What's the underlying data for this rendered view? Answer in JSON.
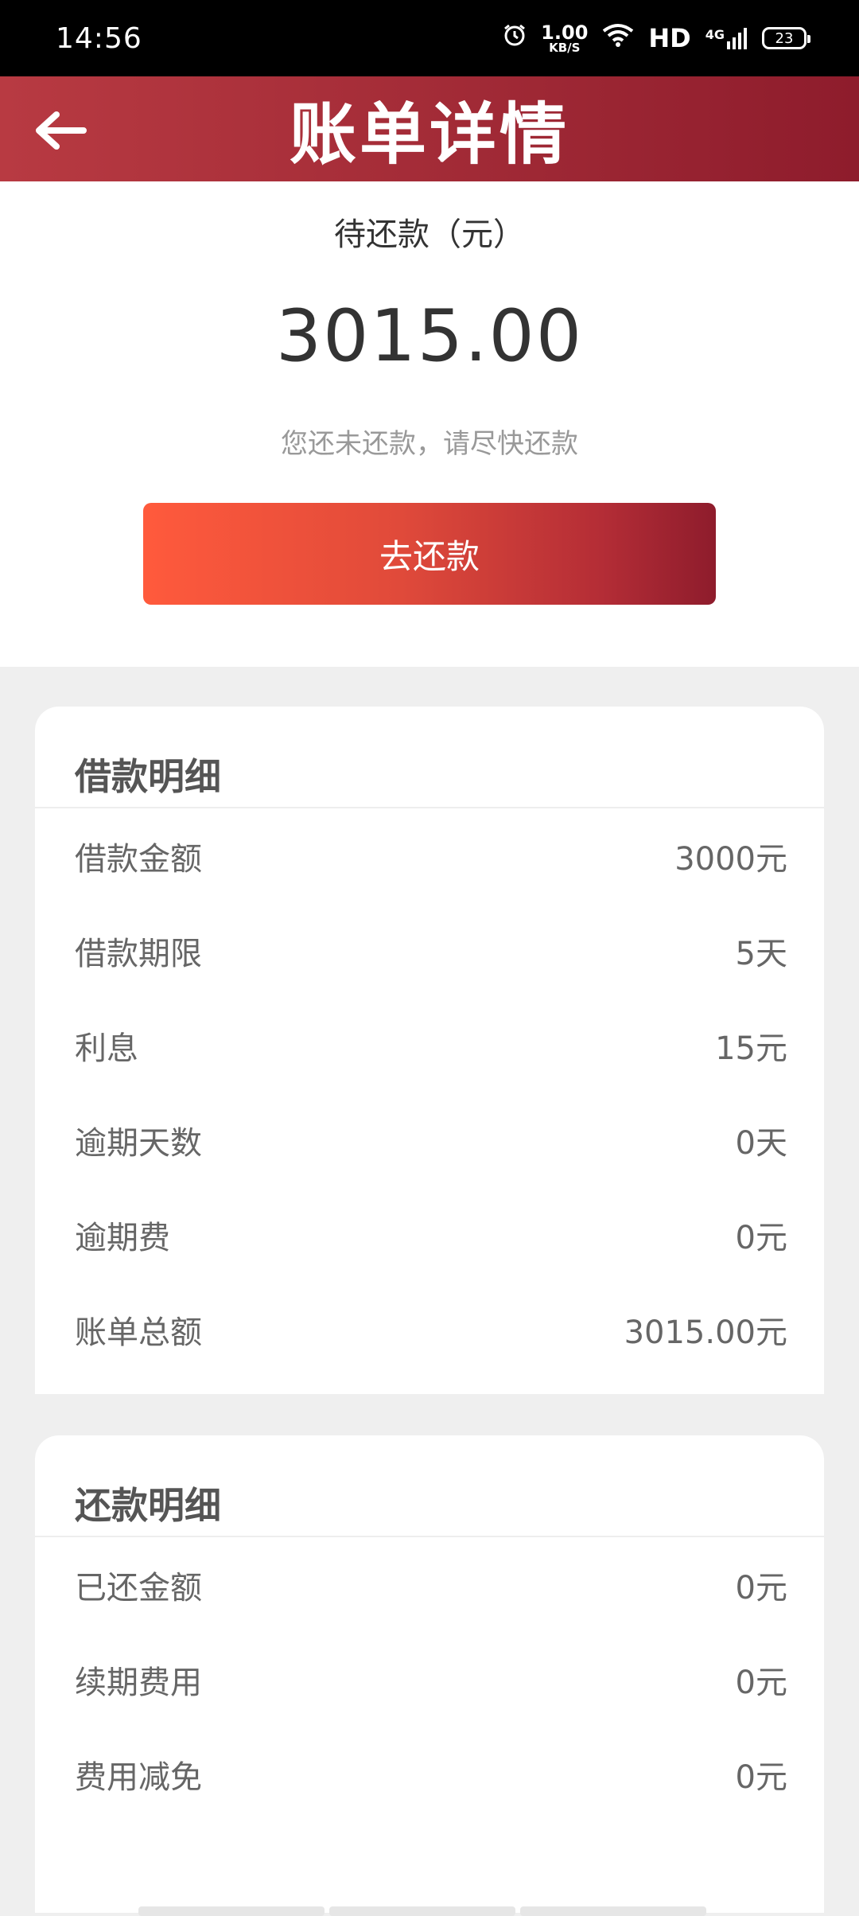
{
  "status_bar": {
    "time": "14:56",
    "net_speed_value": "1.00",
    "net_speed_unit": "KB/S",
    "hd": "HD",
    "network": "4G",
    "battery": "23",
    "icons": [
      "alarm-icon",
      "wifi-icon",
      "signal-icon",
      "battery-icon"
    ]
  },
  "header": {
    "title": "账单详情",
    "back_icon": "back-arrow-icon"
  },
  "summary": {
    "label": "待还款（元）",
    "amount": "3015.00",
    "note": "您还未还款，请尽快还款",
    "button_label": "去还款"
  },
  "loan_details": {
    "title": "借款明细",
    "rows": [
      {
        "label": "借款金额",
        "value": "3000元"
      },
      {
        "label": "借款期限",
        "value": "5天"
      },
      {
        "label": "利息",
        "value": "15元"
      },
      {
        "label": "逾期天数",
        "value": "0天"
      },
      {
        "label": "逾期费",
        "value": "0元"
      },
      {
        "label": "账单总额",
        "value": "3015.00元"
      }
    ]
  },
  "repay_details": {
    "title": "还款明细",
    "rows": [
      {
        "label": "已还金额",
        "value": "0元"
      },
      {
        "label": "续期费用",
        "value": "0元"
      },
      {
        "label": "费用减免",
        "value": "0元"
      }
    ]
  },
  "colors": {
    "header_start": "#b83a42",
    "header_end": "#8e1c2c",
    "button_start": "#ff5a3c",
    "button_end": "#8e1c2c"
  }
}
